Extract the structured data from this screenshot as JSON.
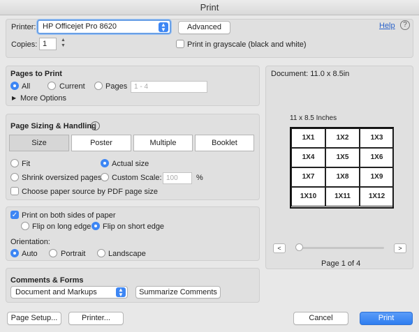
{
  "window": {
    "title": "Print"
  },
  "printer": {
    "label": "Printer:",
    "selected": "HP Officejet Pro 8620",
    "advanced_label": "Advanced",
    "help_label": "Help",
    "help_icon": "?"
  },
  "copies": {
    "label": "Copies:",
    "value": "1",
    "grayscale_label": "Print in grayscale (black and white)"
  },
  "pages_to_print": {
    "header": "Pages to Print",
    "all_label": "All",
    "current_label": "Current",
    "pages_label": "Pages",
    "pages_placeholder": "1 - 4",
    "more_options_label": "More Options"
  },
  "sizing": {
    "header": "Page Sizing & Handling",
    "tabs": [
      "Size",
      "Poster",
      "Multiple",
      "Booklet"
    ],
    "fit_label": "Fit",
    "actual_size_label": "Actual size",
    "shrink_label": "Shrink oversized pages",
    "custom_scale_label": "Custom Scale:",
    "custom_scale_placeholder": "100",
    "percent": "%",
    "paper_source_label": "Choose paper source by PDF page size"
  },
  "duplex": {
    "both_sides_label": "Print on both sides of paper",
    "long_edge_label": "Flip on long edge",
    "short_edge_label": "Flip on short edge"
  },
  "orientation": {
    "label": "Orientation:",
    "auto_label": "Auto",
    "portrait_label": "Portrait",
    "landscape_label": "Landscape"
  },
  "comments": {
    "header": "Comments & Forms",
    "selected": "Document and Markups",
    "summarize_label": "Summarize Comments"
  },
  "preview": {
    "document_size": "Document: 11.0 x 8.5in",
    "paper_label": "11 x 8.5 Inches",
    "cells": [
      "1X1",
      "1X2",
      "1X3",
      "1X4",
      "1X5",
      "1X6",
      "1X7",
      "1X8",
      "1X9",
      "1X10",
      "1X11",
      "1X12"
    ],
    "prev": "<",
    "next": ">",
    "page_indicator": "Page 1 of 4"
  },
  "footer": {
    "page_setup_label": "Page Setup...",
    "printer_label": "Printer...",
    "cancel_label": "Cancel",
    "print_label": "Print"
  }
}
